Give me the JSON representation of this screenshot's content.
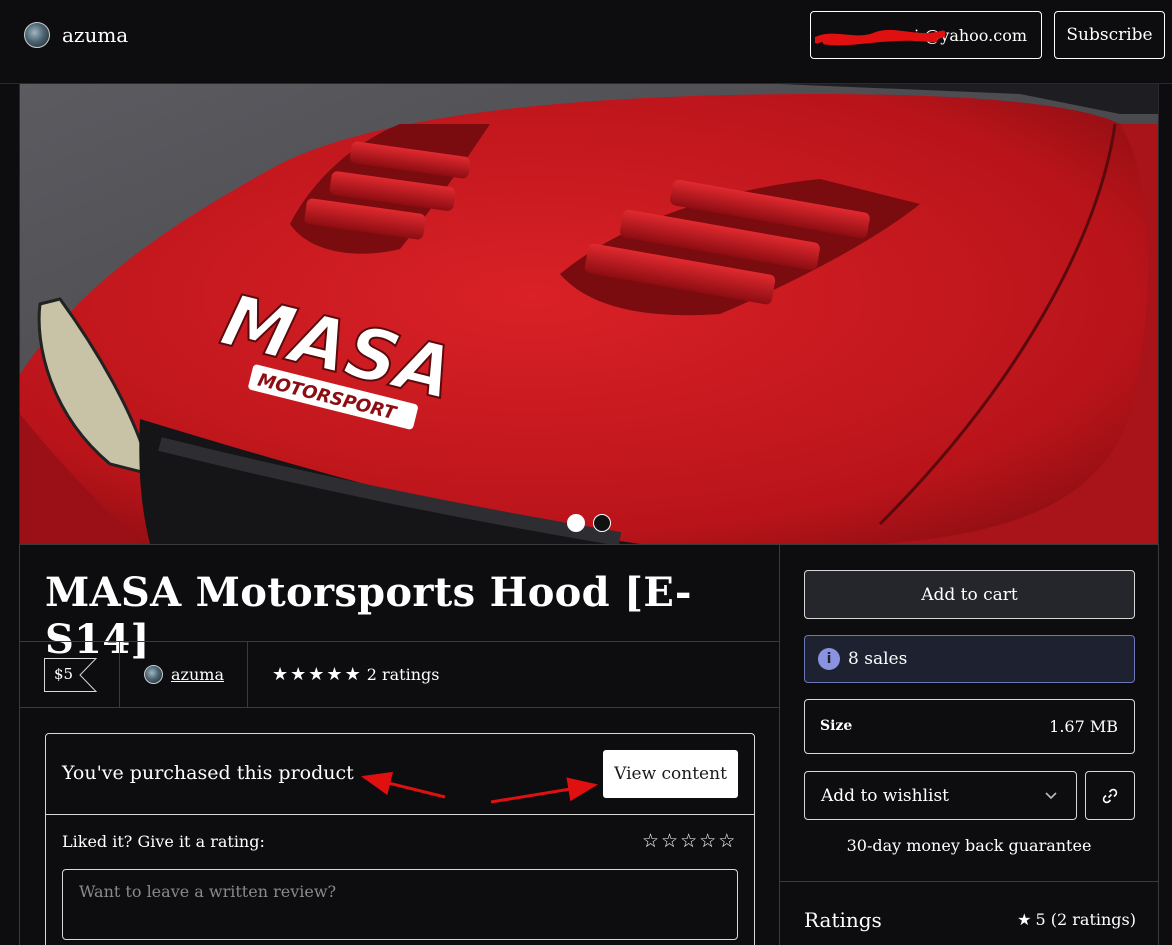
{
  "header": {
    "brand_name": "azuma",
    "email_value": "i        @yahoo.com",
    "subscribe_label": "Subscribe"
  },
  "gallery": {
    "hood_logo_text": "MASA",
    "hood_logo_subtext": "MOTORSPORT",
    "slide_count": 2,
    "active_slide": 1
  },
  "product": {
    "title": "MASA Motorsports Hood [E-S14]",
    "price": "$5",
    "seller": "azuma",
    "rating_stars": 5,
    "ratings_count_label": "2 ratings"
  },
  "purchase": {
    "status_text": "You've purchased this product",
    "view_content_label": "View content",
    "rate_label": "Liked it? Give it a rating:",
    "review_placeholder": "Want to leave a written review?"
  },
  "sidebar": {
    "add_to_cart_label": "Add to cart",
    "sales_text": "8 sales",
    "size_label": "Size",
    "size_value": "1.67 MB",
    "wishlist_label": "Add to wishlist",
    "guarantee_text": "30-day money back guarantee",
    "ratings_title": "Ratings",
    "ratings_summary": "5 (2 ratings)"
  },
  "colors": {
    "background": "#0d0d0f",
    "sales_box_bg": "#1e2230",
    "sales_box_border": "#6b75b8",
    "info_icon": "#8a93e0",
    "car_red": "#c8161c",
    "annotation_arrow": "#e01010"
  },
  "icons": {
    "info": "info-icon",
    "chevron": "chevron-down-icon",
    "link": "link-icon",
    "star": "star-icon"
  }
}
